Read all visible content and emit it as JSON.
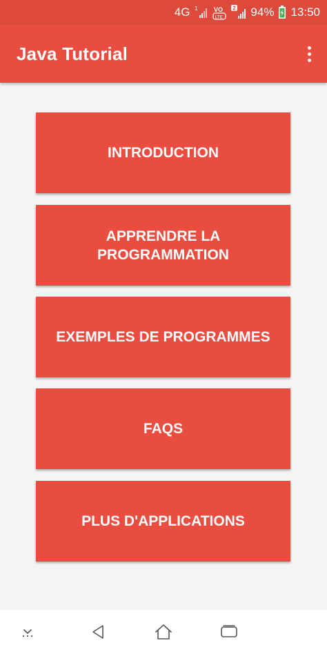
{
  "status_bar": {
    "network": "4G",
    "sim1_label": "1",
    "volte": "VO LTE",
    "sim2_label": "2",
    "battery": "94%",
    "time": "13:50"
  },
  "app_bar": {
    "title": "Java Tutorial",
    "overflow_icon": "more-vert-icon"
  },
  "menu": {
    "items": [
      {
        "label": "INTRODUCTION"
      },
      {
        "label": "APPRENDRE LA\nPROGRAMMATION"
      },
      {
        "label": "EXEMPLES DE PROGRAMMES"
      },
      {
        "label": "FAQS"
      },
      {
        "label": "PLUS D'APPLICATIONS"
      }
    ]
  },
  "nav_bar": {
    "icons": [
      "hide-nav-icon",
      "back-icon",
      "home-icon",
      "recents-icon"
    ]
  },
  "colors": {
    "status_bar": "#dd4a3c",
    "primary": "#e94d40",
    "background": "#f4f4f4"
  }
}
